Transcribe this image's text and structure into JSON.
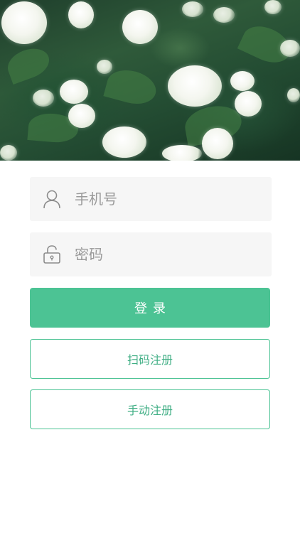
{
  "login": {
    "phone_placeholder": "手机号",
    "password_placeholder": "密码",
    "login_label": "登录",
    "scan_register_label": "扫码注册",
    "manual_register_label": "手动注册"
  },
  "colors": {
    "accent": "#4cc394",
    "field_bg": "#f6f6f6",
    "placeholder": "#9a9a9a",
    "icon": "#8c8c8c"
  },
  "icons": {
    "phone_field": "user-icon",
    "password_field": "unlock-icon"
  }
}
